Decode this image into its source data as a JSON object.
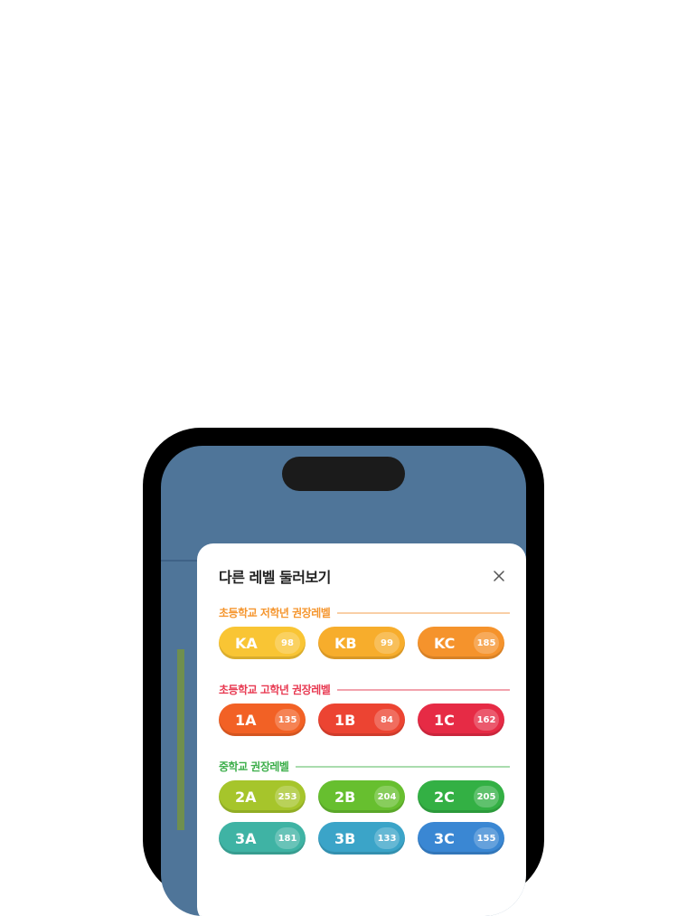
{
  "modal": {
    "title": "다른 레벨 둘러보기",
    "close_icon": "close-icon"
  },
  "sections": [
    {
      "label": "초등학교 저학년 권장레벨",
      "color": "#f5962f",
      "line_color": "#f9cfa6",
      "levels": [
        {
          "code": "KA",
          "count": "98",
          "color": "#f9c534"
        },
        {
          "code": "KB",
          "count": "99",
          "color": "#f7ad2c"
        },
        {
          "code": "KC",
          "count": "185",
          "color": "#f5932c"
        }
      ]
    },
    {
      "label": "초등학교 고학년 권장레벨",
      "color": "#e83a52",
      "line_color": "#f2a2ad",
      "levels": [
        {
          "code": "1A",
          "count": "135",
          "color": "#f26125"
        },
        {
          "code": "1B",
          "count": "84",
          "color": "#ec4432"
        },
        {
          "code": "1C",
          "count": "162",
          "color": "#e62b45"
        }
      ]
    },
    {
      "label": "중학교 권장레벨",
      "color": "#3cae4a",
      "line_color": "#a9dcae",
      "levels": [
        {
          "code": "2A",
          "count": "253",
          "color": "#a6c52b"
        },
        {
          "code": "2B",
          "count": "204",
          "color": "#67bf2f"
        },
        {
          "code": "2C",
          "count": "205",
          "color": "#33b044"
        },
        {
          "code": "3A",
          "count": "181",
          "color": "#3fb3a4"
        },
        {
          "code": "3B",
          "count": "133",
          "color": "#3ba4c8"
        },
        {
          "code": "3C",
          "count": "155",
          "color": "#3a87d3"
        }
      ]
    }
  ]
}
